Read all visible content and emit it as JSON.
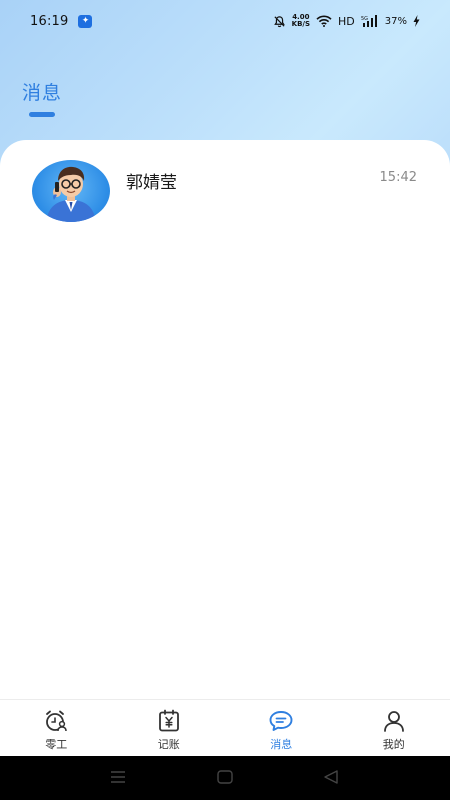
{
  "status_bar": {
    "time": "16:19",
    "network_speed_value": "4.00",
    "network_speed_unit": "KB/S",
    "hd": "HD",
    "signal_label": "5G",
    "battery": "37%"
  },
  "header": {
    "title": "消息"
  },
  "conversations": [
    {
      "name": "郭婧莹",
      "time": "15:42",
      "avatar_icon": "businessman-avatar"
    }
  ],
  "tab_bar": {
    "tabs": [
      {
        "label": "零工",
        "icon": "alarm-worker-icon",
        "active": false
      },
      {
        "label": "记账",
        "icon": "ledger-yen-icon",
        "active": false
      },
      {
        "label": "消息",
        "icon": "chat-bubble-icon",
        "active": true
      },
      {
        "label": "我的",
        "icon": "user-icon",
        "active": false
      }
    ]
  },
  "colors": {
    "accent": "#2f7fe0",
    "header_gradient_start": "#a9d2f7",
    "header_gradient_end": "#c9e9fd"
  }
}
